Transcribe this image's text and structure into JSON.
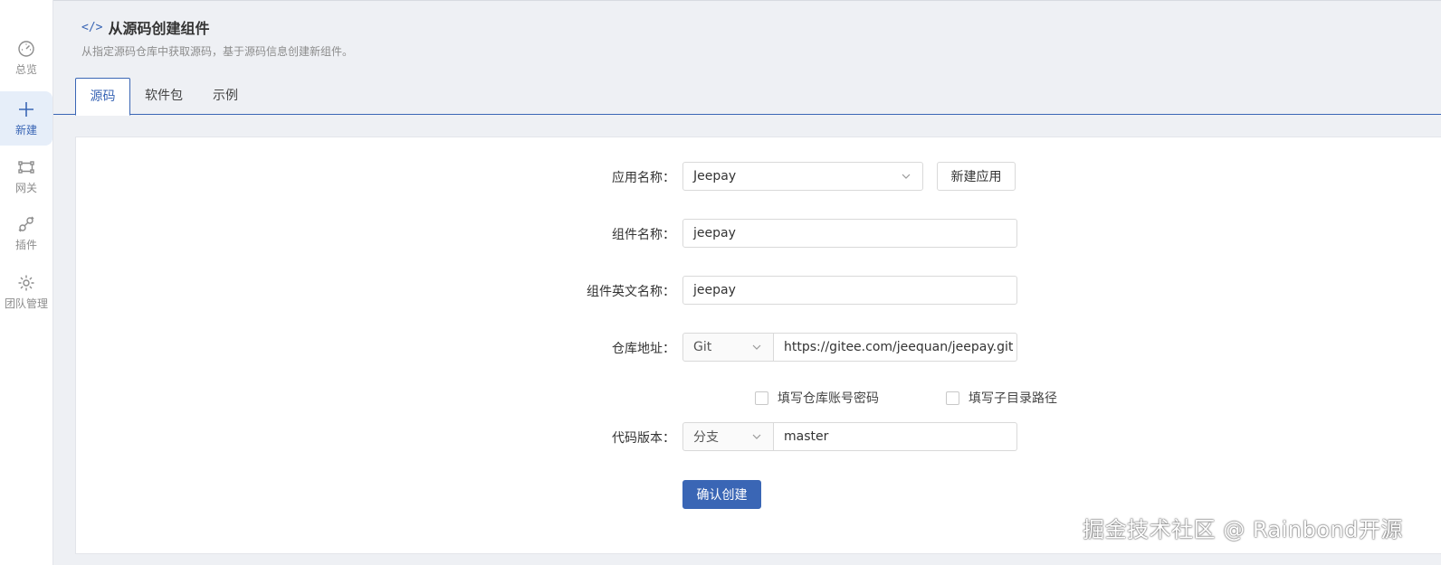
{
  "sidebar": {
    "items": [
      {
        "label": "总览",
        "icon": "dashboard-icon",
        "active": false
      },
      {
        "label": "新建",
        "icon": "plus-icon",
        "active": true
      },
      {
        "label": "网关",
        "icon": "gateway-icon",
        "active": false
      },
      {
        "label": "插件",
        "icon": "plugin-icon",
        "active": false
      },
      {
        "label": "团队管理",
        "icon": "gear-icon",
        "active": false
      }
    ]
  },
  "header": {
    "title": "从源码创建组件",
    "description": "从指定源码仓库中获取源码，基于源码信息创建新组件。"
  },
  "tabs": [
    {
      "label": "源码",
      "active": true
    },
    {
      "label": "软件包",
      "active": false
    },
    {
      "label": "示例",
      "active": false
    }
  ],
  "form": {
    "app_name": {
      "label": "应用名称：",
      "value": "Jeepay",
      "new_app_button": "新建应用"
    },
    "component_name": {
      "label": "组件名称：",
      "value": "jeepay"
    },
    "component_en_name": {
      "label": "组件英文名称：",
      "value": "jeepay"
    },
    "repo": {
      "label": "仓库地址：",
      "type": "Git",
      "url": "https://gitee.com/jeequan/jeepay.git"
    },
    "checkboxes": {
      "credentials": "填写仓库账号密码",
      "subdir": "填写子目录路径"
    },
    "version": {
      "label": "代码版本：",
      "type": "分支",
      "value": "master"
    },
    "submit": "确认创建"
  },
  "watermark": "掘金技术社区 @ Rainbond开源",
  "colors": {
    "primary": "#3a66b5",
    "background": "#eef0f4"
  }
}
